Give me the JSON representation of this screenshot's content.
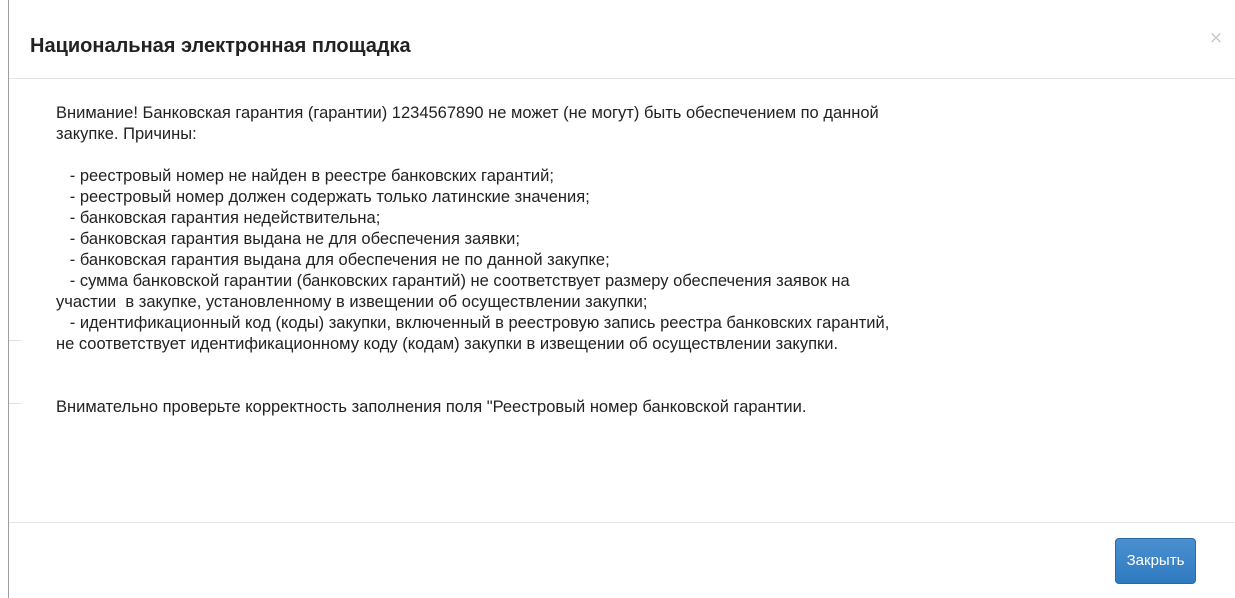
{
  "dialog": {
    "title": "Национальная электронная площадка",
    "close_glyph": "×",
    "close_icon": "close-icon"
  },
  "body": {
    "lines": [
      "Внимание! Банковская гарантия (гарантии) 1234567890 не может (не могут) быть обеспечением по данной",
      "закупке. Причины:",
      "",
      "   - реестровый номер не найден в реестре банковских гарантий;",
      "   - реестровый номер должен содержать только латинские значения;",
      "   - банковская гарантия недействительна;",
      "   - банковская гарантия выдана не для обеспечения заявки;",
      "   - банковская гарантия выдана для обеспечения не по данной закупке;",
      "   - сумма банковской гарантии (банковских гарантий) не соответствует размеру обеспечения заявок на",
      "участии  в закупке, установленному в извещении об осуществлении закупки;",
      "   - идентификационный код (коды) закупки, включенный в реестровую запись реестра банковских гарантий,",
      "не соответствует идентификационному коду (кодам) закупки в извещении об осуществлении закупки.",
      "",
      "",
      "Внимательно проверьте корректность заполнения поля \"Реестровый номер банковской гарантии."
    ]
  },
  "footer": {
    "close_button_label": "Закрыть",
    "button_color": "#337ab7"
  }
}
